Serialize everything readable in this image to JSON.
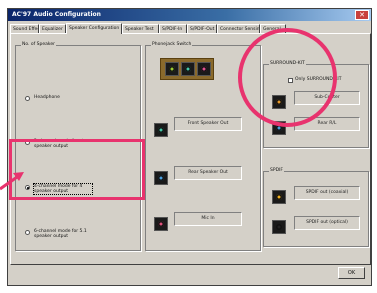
{
  "window": {
    "title": "AC'97 Audio Configuration",
    "close_glyph": "✕"
  },
  "tabs": [
    {
      "label": "Sound Effect"
    },
    {
      "label": "Equalizer"
    },
    {
      "label": "Speaker Configuration"
    },
    {
      "label": "Speaker Test"
    },
    {
      "label": "S/PDIF-In"
    },
    {
      "label": "S/PDIF-Out"
    },
    {
      "label": "Connector Sensing"
    },
    {
      "label": "General"
    }
  ],
  "speakers": {
    "group_label": "No. of Speaker",
    "options": [
      {
        "label": "Headphone",
        "selected": false
      },
      {
        "label": "2-channel mode for stereo speaker output",
        "selected": false
      },
      {
        "label": "4-channel mode for 4 speaker output",
        "selected": true
      },
      {
        "label": "6-channel mode for 5.1 speaker output",
        "selected": false
      }
    ]
  },
  "jacks": {
    "group_label": "Phonejack Switch",
    "rows": [
      {
        "label": "Front Speaker Out",
        "color": "#44c8a8"
      },
      {
        "label": "Rear Speaker Out",
        "color": "#4aa0e0"
      },
      {
        "label": "Mic In",
        "color": "#e0507a"
      }
    ],
    "strip_colors": [
      "#9ccc33",
      "#44c8a8",
      "#e05090"
    ]
  },
  "surround": {
    "group_label": "SURROUND-KIT",
    "checkbox_label": "Only SURROUND-KIT",
    "checked": false,
    "rows": [
      {
        "label": "Sub-Center",
        "color": "#e89a2a"
      },
      {
        "label": "Rear R/L",
        "color": "#4aa0e0"
      }
    ]
  },
  "spdif": {
    "group_label": "SPDIF",
    "rows": [
      {
        "label": "SPDIF out (coaxial)",
        "color": "#f0b020"
      },
      {
        "label": "SPDIF out (optical)",
        "color": "#222222"
      }
    ]
  },
  "footer": {
    "ok_label": "OK"
  },
  "annotation": {
    "color": "#e8336e"
  }
}
